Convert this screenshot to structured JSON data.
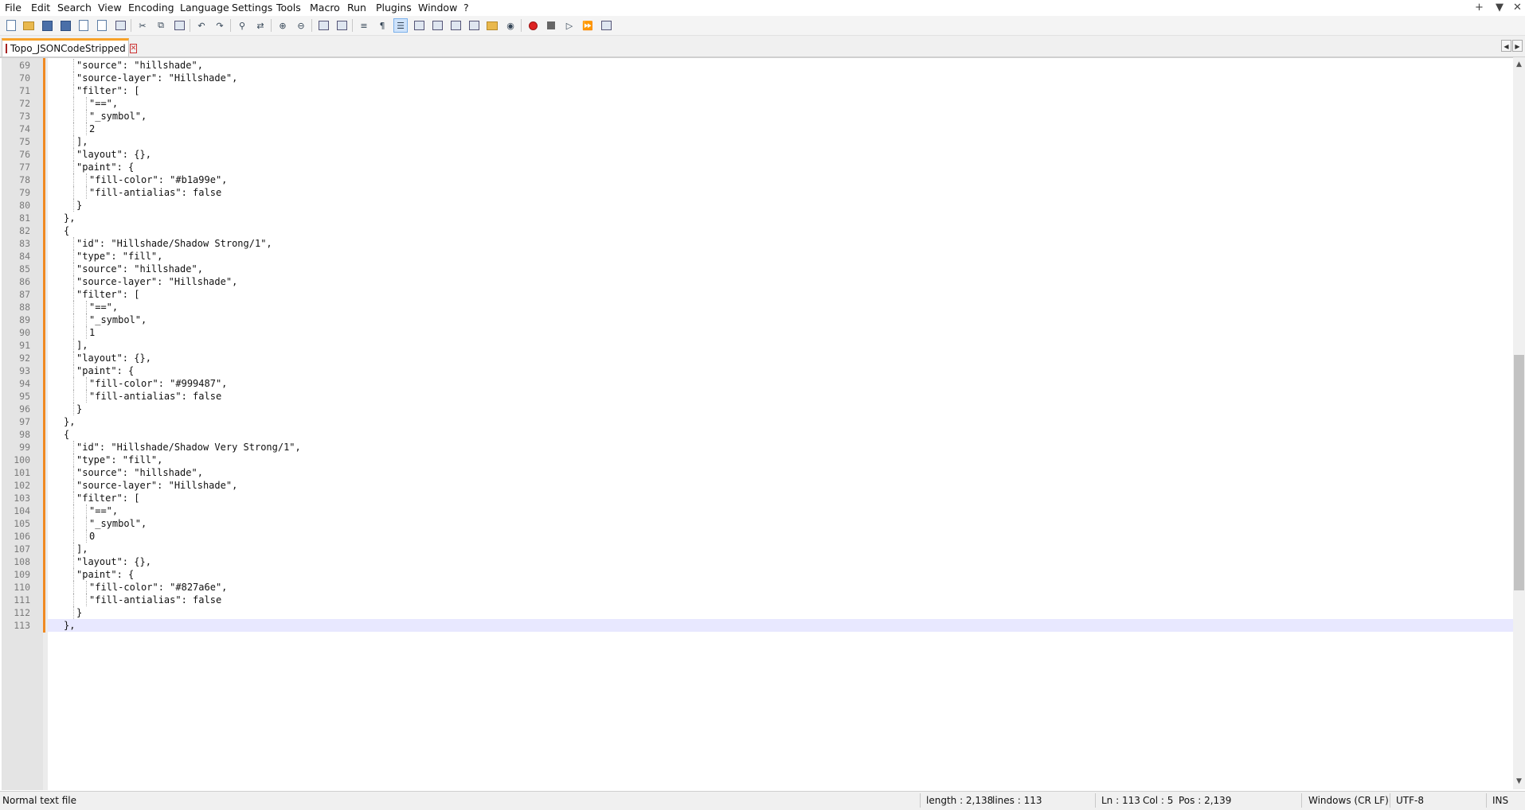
{
  "menu": {
    "items": [
      "File",
      "Edit",
      "Search",
      "View",
      "Encoding",
      "Language",
      "Settings",
      "Tools",
      "Macro",
      "Run",
      "Plugins",
      "Window",
      "?"
    ],
    "window_controls": [
      "+",
      "▼",
      "✕"
    ]
  },
  "toolbar": {
    "buttons": [
      {
        "name": "new-file-icon",
        "glyph": "doc"
      },
      {
        "name": "open-file-icon",
        "glyph": "folder"
      },
      {
        "name": "save-icon",
        "glyph": "disk"
      },
      {
        "name": "save-all-icon",
        "glyph": "disk"
      },
      {
        "name": "close-icon",
        "glyph": "doc"
      },
      {
        "name": "close-all-icon",
        "glyph": "doc"
      },
      {
        "name": "print-icon",
        "glyph": "box"
      },
      {
        "name": "cut-icon",
        "glyph": "✂"
      },
      {
        "name": "copy-icon",
        "glyph": "⧉"
      },
      {
        "name": "paste-icon",
        "glyph": "box"
      },
      {
        "name": "undo-icon",
        "glyph": "↶"
      },
      {
        "name": "redo-icon",
        "glyph": "↷"
      },
      {
        "name": "find-icon",
        "glyph": "⚲"
      },
      {
        "name": "replace-icon",
        "glyph": "⇄"
      },
      {
        "name": "zoom-in-icon",
        "glyph": "⊕"
      },
      {
        "name": "zoom-out-icon",
        "glyph": "⊖"
      },
      {
        "name": "sync-vertical-icon",
        "glyph": "box"
      },
      {
        "name": "sync-horizontal-icon",
        "glyph": "box"
      },
      {
        "name": "word-wrap-icon",
        "glyph": "≡"
      },
      {
        "name": "show-all-characters-icon",
        "glyph": "¶"
      },
      {
        "name": "indent-guide-icon",
        "glyph": "☰",
        "active": true
      },
      {
        "name": "language-define-icon",
        "glyph": "box"
      },
      {
        "name": "doc-map-icon",
        "glyph": "box"
      },
      {
        "name": "document-list-icon",
        "glyph": "box"
      },
      {
        "name": "function-list-icon",
        "glyph": "box"
      },
      {
        "name": "folder-as-workspace-icon",
        "glyph": "folder"
      },
      {
        "name": "monitoring-icon",
        "glyph": "◉"
      },
      {
        "name": "start-recording-icon",
        "glyph": "rec"
      },
      {
        "name": "stop-recording-icon",
        "glyph": "stop"
      },
      {
        "name": "playback-icon",
        "glyph": "▷"
      },
      {
        "name": "run-macro-multiple-icon",
        "glyph": "⏩"
      },
      {
        "name": "save-macro-icon",
        "glyph": "box"
      }
    ]
  },
  "tab": {
    "label": "Topo_JSONCodeStripped",
    "close_glyph": "✕"
  },
  "tab_nav": {
    "left": "◀",
    "right": "▶"
  },
  "editor": {
    "lines": [
      {
        "n": "69",
        "indent": 2,
        "text": "\"source\": \"hillshade\","
      },
      {
        "n": "70",
        "indent": 2,
        "text": "\"source-layer\": \"Hillshade\","
      },
      {
        "n": "71",
        "indent": 2,
        "text": "\"filter\": ["
      },
      {
        "n": "72",
        "indent": 3,
        "text": "\"==\","
      },
      {
        "n": "73",
        "indent": 3,
        "text": "\"_symbol\","
      },
      {
        "n": "74",
        "indent": 3,
        "text": "2"
      },
      {
        "n": "75",
        "indent": 2,
        "text": "],"
      },
      {
        "n": "76",
        "indent": 2,
        "text": "\"layout\": {},"
      },
      {
        "n": "77",
        "indent": 2,
        "text": "\"paint\": {"
      },
      {
        "n": "78",
        "indent": 3,
        "text": "\"fill-color\": \"#b1a99e\","
      },
      {
        "n": "79",
        "indent": 3,
        "text": "\"fill-antialias\": false"
      },
      {
        "n": "80",
        "indent": 2,
        "text": "}"
      },
      {
        "n": "81",
        "indent": 1,
        "text": "},"
      },
      {
        "n": "82",
        "indent": 1,
        "text": "{"
      },
      {
        "n": "83",
        "indent": 2,
        "text": "\"id\": \"Hillshade/Shadow Strong/1\","
      },
      {
        "n": "84",
        "indent": 2,
        "text": "\"type\": \"fill\","
      },
      {
        "n": "85",
        "indent": 2,
        "text": "\"source\": \"hillshade\","
      },
      {
        "n": "86",
        "indent": 2,
        "text": "\"source-layer\": \"Hillshade\","
      },
      {
        "n": "87",
        "indent": 2,
        "text": "\"filter\": ["
      },
      {
        "n": "88",
        "indent": 3,
        "text": "\"==\","
      },
      {
        "n": "89",
        "indent": 3,
        "text": "\"_symbol\","
      },
      {
        "n": "90",
        "indent": 3,
        "text": "1"
      },
      {
        "n": "91",
        "indent": 2,
        "text": "],"
      },
      {
        "n": "92",
        "indent": 2,
        "text": "\"layout\": {},"
      },
      {
        "n": "93",
        "indent": 2,
        "text": "\"paint\": {"
      },
      {
        "n": "94",
        "indent": 3,
        "text": "\"fill-color\": \"#999487\","
      },
      {
        "n": "95",
        "indent": 3,
        "text": "\"fill-antialias\": false"
      },
      {
        "n": "96",
        "indent": 2,
        "text": "}"
      },
      {
        "n": "97",
        "indent": 1,
        "text": "},"
      },
      {
        "n": "98",
        "indent": 1,
        "text": "{"
      },
      {
        "n": "99",
        "indent": 2,
        "text": "\"id\": \"Hillshade/Shadow Very Strong/1\","
      },
      {
        "n": "100",
        "indent": 2,
        "text": "\"type\": \"fill\","
      },
      {
        "n": "101",
        "indent": 2,
        "text": "\"source\": \"hillshade\","
      },
      {
        "n": "102",
        "indent": 2,
        "text": "\"source-layer\": \"Hillshade\","
      },
      {
        "n": "103",
        "indent": 2,
        "text": "\"filter\": ["
      },
      {
        "n": "104",
        "indent": 3,
        "text": "\"==\","
      },
      {
        "n": "105",
        "indent": 3,
        "text": "\"_symbol\","
      },
      {
        "n": "106",
        "indent": 3,
        "text": "0"
      },
      {
        "n": "107",
        "indent": 2,
        "text": "],"
      },
      {
        "n": "108",
        "indent": 2,
        "text": "\"layout\": {},"
      },
      {
        "n": "109",
        "indent": 2,
        "text": "\"paint\": {"
      },
      {
        "n": "110",
        "indent": 3,
        "text": "\"fill-color\": \"#827a6e\","
      },
      {
        "n": "111",
        "indent": 3,
        "text": "\"fill-antialias\": false"
      },
      {
        "n": "112",
        "indent": 2,
        "text": "}"
      },
      {
        "n": "113",
        "indent": 1,
        "text": "},",
        "current": true
      }
    ]
  },
  "scrollbar": {
    "up": "▲",
    "down": "▼"
  },
  "status": {
    "file_type": "Normal text file",
    "length": "length : 2,138",
    "lines": "lines : 113",
    "ln": "Ln : 113",
    "col": "Col : 5",
    "pos": "Pos : 2,139",
    "eol": "Windows (CR LF)",
    "encoding": "UTF-8",
    "mode": "INS"
  },
  "colors": {
    "accent": "#f7a22a",
    "change_bar": "#f08a23",
    "current_line": "#e8e8ff",
    "gutter": "#e4e4e4"
  }
}
